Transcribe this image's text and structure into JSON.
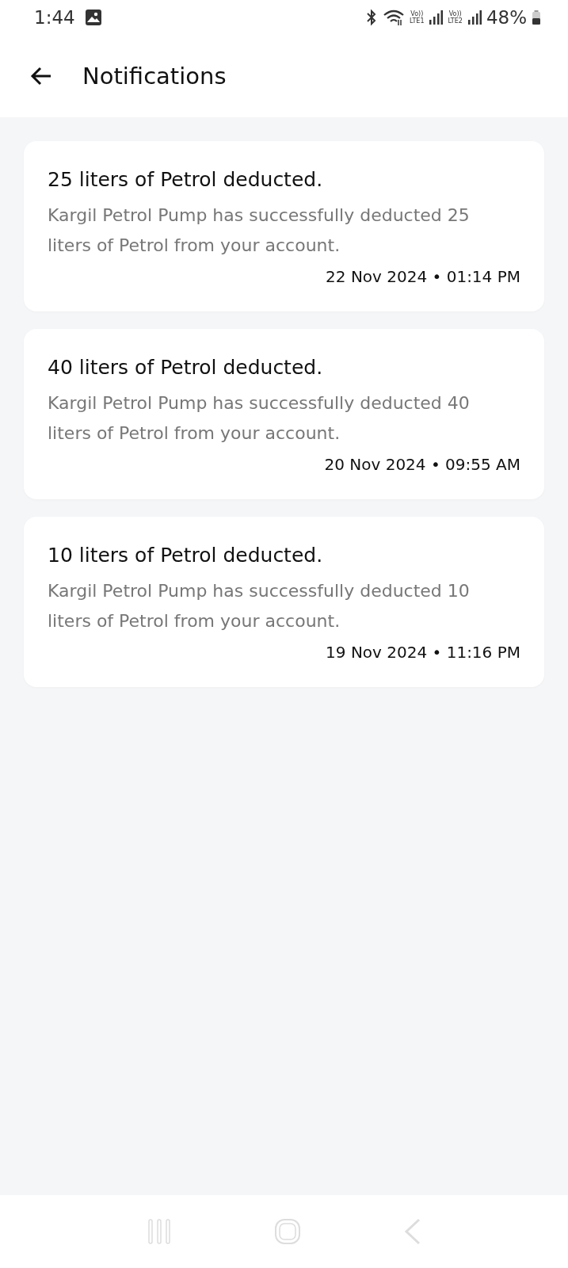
{
  "status_bar": {
    "time": "1:44",
    "network_labels": [
      {
        "top": "Vo))",
        "bottom": "LTE1"
      },
      {
        "top": "Vo))",
        "bottom": "LTE2"
      }
    ],
    "battery": "48%"
  },
  "header": {
    "title": "Notifications"
  },
  "notifications": [
    {
      "title": "25 liters of Petrol deducted.",
      "message": "Kargil Petrol Pump has successfully deducted 25 liters of Petrol from your account.",
      "timestamp": "22 Nov 2024 • 01:14 PM"
    },
    {
      "title": "40 liters of Petrol deducted.",
      "message": "Kargil Petrol Pump has successfully deducted 40 liters of Petrol from your account.",
      "timestamp": "20 Nov 2024 • 09:55 AM"
    },
    {
      "title": "10 liters of Petrol deducted.",
      "message": "Kargil Petrol Pump has successfully deducted 10 liters of Petrol from your account.",
      "timestamp": "19 Nov 2024 • 11:16 PM"
    }
  ]
}
